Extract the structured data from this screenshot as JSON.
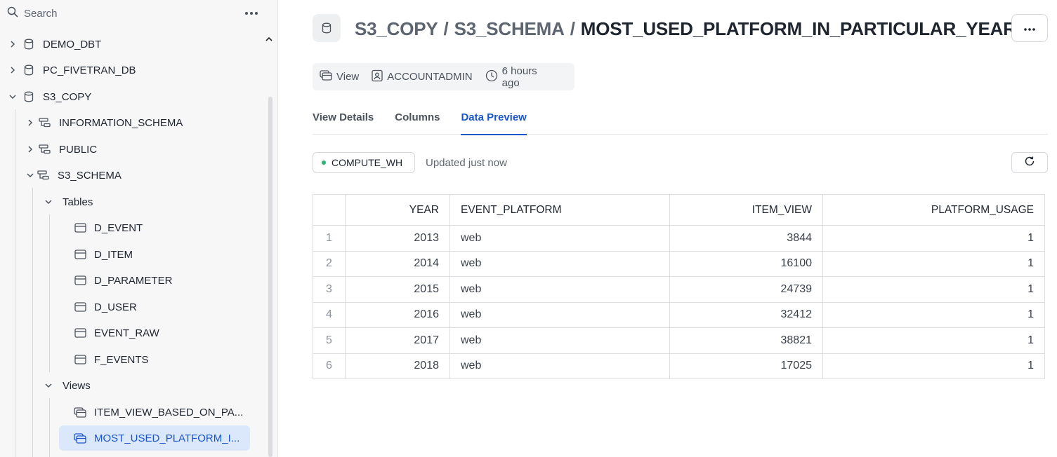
{
  "sidebar": {
    "search_label": "Search",
    "tree": {
      "db1": "DEMO_DBT",
      "db2": "PC_FIVETRAN_DB",
      "db3": "S3_COPY",
      "schema1": "INFORMATION_SCHEMA",
      "schema2": "PUBLIC",
      "schema3": "S3_SCHEMA",
      "tables_group": "Tables",
      "tables": [
        "D_EVENT",
        "D_ITEM",
        "D_PARAMETER",
        "D_USER",
        "EVENT_RAW",
        "F_EVENTS"
      ],
      "views_group": "Views",
      "views": [
        "ITEM_VIEW_BASED_ON_PA...",
        "MOST_USED_PLATFORM_I..."
      ]
    }
  },
  "header": {
    "breadcrumb_db": "S3_COPY",
    "breadcrumb_schema": "S3_SCHEMA",
    "separator": "/",
    "object_name": "MOST_USED_PLATFORM_IN_PARTICULAR_YEAR"
  },
  "meta": {
    "type": "View",
    "owner": "ACCOUNTADMIN",
    "modified": "6 hours ago"
  },
  "tabs": [
    "View Details",
    "Columns",
    "Data Preview"
  ],
  "active_tab": "Data Preview",
  "preview": {
    "warehouse": "COMPUTE_WH",
    "updated": "Updated just now",
    "columns": [
      "YEAR",
      "EVENT_PLATFORM",
      "ITEM_VIEW",
      "PLATFORM_USAGE"
    ],
    "rows": [
      {
        "idx": "1",
        "year": "2013",
        "platform": "web",
        "item_view": "3844",
        "usage": "1"
      },
      {
        "idx": "2",
        "year": "2014",
        "platform": "web",
        "item_view": "16100",
        "usage": "1"
      },
      {
        "idx": "3",
        "year": "2015",
        "platform": "web",
        "item_view": "24739",
        "usage": "1"
      },
      {
        "idx": "4",
        "year": "2016",
        "platform": "web",
        "item_view": "32412",
        "usage": "1"
      },
      {
        "idx": "5",
        "year": "2017",
        "platform": "web",
        "item_view": "38821",
        "usage": "1"
      },
      {
        "idx": "6",
        "year": "2018",
        "platform": "web",
        "item_view": "17025",
        "usage": "1"
      }
    ]
  },
  "colors": {
    "accent": "#1b56c9",
    "selected_bg": "#dbe7fb",
    "status_dot": "#29b37c"
  }
}
